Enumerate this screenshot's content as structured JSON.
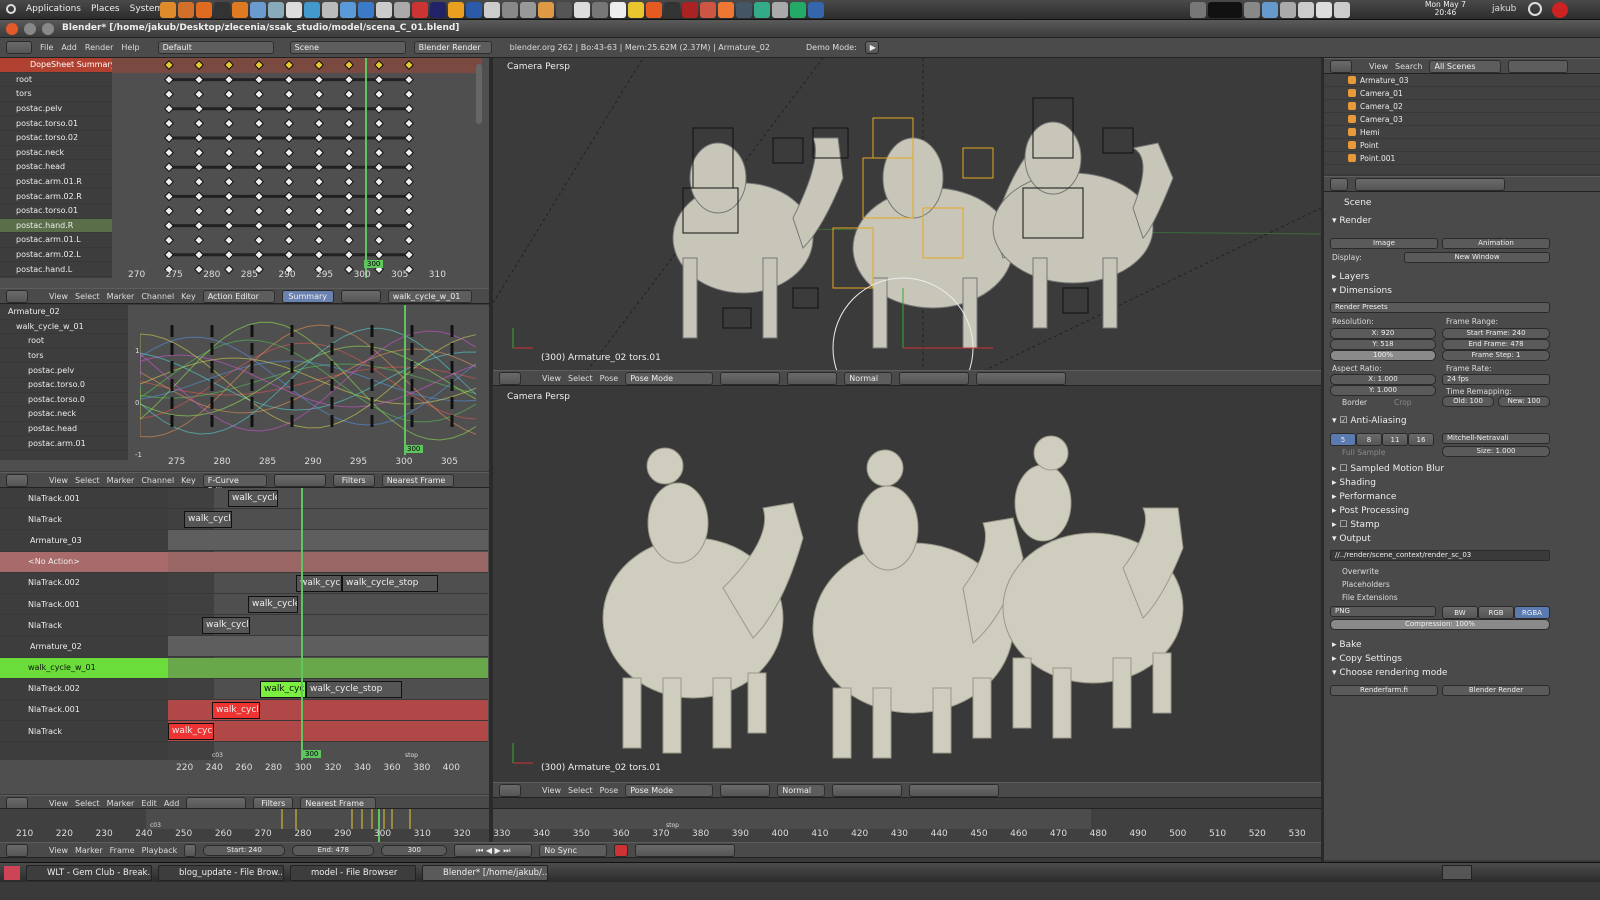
{
  "system_panel": {
    "menus": [
      "Applications",
      "Places",
      "System"
    ],
    "datetime_line1": "Mon May 7",
    "datetime_line2": "20:46",
    "user": "jakub"
  },
  "window": {
    "title": "Blender* [/home/jakub/Desktop/zlecenia/ssak_studio/model/scena_C_01.blend]"
  },
  "info_header": {
    "menus": [
      "File",
      "Add",
      "Render",
      "Help"
    ],
    "layout": "Default",
    "scene": "Scene",
    "engine": "Blender Render",
    "stats": "blender.org 262 | Bo:43-63 | Mem:25.62M (2.37M) | Armature_02",
    "demo_mode": "Demo Mode:"
  },
  "dopesheet": {
    "summary_label": "DopeSheet Summary",
    "channels": [
      "root",
      "tors",
      "postac.pelv",
      "postac.torso.01",
      "postac.torso.02",
      "postac.neck",
      "postac.head",
      "postac.arm.01.R",
      "postac.arm.02.R",
      "postac.torso.01",
      "postac.hand.R",
      "postac.arm.01.L",
      "postac.arm.02.L",
      "postac.hand.L"
    ],
    "ruler": [
      "270",
      "275",
      "280",
      "285",
      "290",
      "295",
      "300",
      "305",
      "310"
    ],
    "current_frame": "300",
    "header_menus": [
      "View",
      "Select",
      "Marker",
      "Channel",
      "Key"
    ],
    "mode": "Action Editor",
    "summary_btn": "Summary",
    "action": "walk_cycle_w_01"
  },
  "fcurve": {
    "channels": [
      "Armature_02",
      "walk_cycle_w_01",
      "root",
      "tors",
      "postac.pelv",
      "postac.torso.0",
      "postac.torso.0",
      "postac.neck",
      "postac.head",
      "postac.arm.01"
    ],
    "ruler": [
      "275",
      "280",
      "285",
      "290",
      "295",
      "300",
      "305"
    ],
    "current_frame": "300",
    "yticks": [
      "1",
      "0",
      "-1"
    ],
    "header_menus": [
      "View",
      "Select",
      "Marker",
      "Channel",
      "Key"
    ],
    "mode": "F-Curve Editor",
    "filters": "Filters",
    "snap": "Nearest Frame"
  },
  "nla": {
    "tracks": [
      {
        "name": "NlaTrack.001",
        "type": "track"
      },
      {
        "name": "NlaTrack",
        "type": "track"
      },
      {
        "name": "Armature_03",
        "type": "object"
      },
      {
        "name": "<No Action>",
        "type": "noaction"
      },
      {
        "name": "NlaTrack.002",
        "type": "track"
      },
      {
        "name": "NlaTrack.001",
        "type": "track"
      },
      {
        "name": "NlaTrack",
        "type": "track"
      },
      {
        "name": "Armature_02",
        "type": "object"
      },
      {
        "name": "walk_cycle_w_01",
        "type": "action"
      },
      {
        "name": "NlaTrack.002",
        "type": "track"
      },
      {
        "name": "NlaTrack.001",
        "type": "track"
      },
      {
        "name": "NlaTrack",
        "type": "track"
      }
    ],
    "strips": [
      {
        "label": "walk_cycle",
        "row": 0
      },
      {
        "label": "walk_cycle",
        "row": 1
      },
      {
        "label": "walk_cycl",
        "row": 4
      },
      {
        "label": "walk_cycle_stop",
        "row": 4
      },
      {
        "label": "walk_cycle",
        "row": 5
      },
      {
        "label": "walk_cycle",
        "row": 6
      },
      {
        "label": "walk_cycle",
        "row": 9
      },
      {
        "label": "walk_cycle_stop",
        "row": 9
      },
      {
        "label": "walk_cycle",
        "row": 10
      },
      {
        "label": "walk_cycle",
        "row": 11
      }
    ],
    "ruler": [
      "220",
      "240",
      "260",
      "280",
      "300",
      "320",
      "340",
      "360",
      "380",
      "400"
    ],
    "current_frame": "300",
    "markers": [
      "c03",
      "stop"
    ],
    "header_menus": [
      "View",
      "Select",
      "Marker",
      "Edit",
      "Add"
    ],
    "filters": "Filters",
    "snap": "Nearest Frame"
  },
  "viewport_top": {
    "label": "Camera Persp",
    "status": "(300) Armature_02 tors.01",
    "menus": [
      "View",
      "Select",
      "Pose"
    ],
    "mode": "Pose Mode",
    "orientation": "Normal"
  },
  "viewport_bottom": {
    "label": "Camera Persp",
    "status": "(300) Armature_02 tors.01",
    "menus": [
      "View",
      "Select",
      "Pose"
    ],
    "mode": "Pose Mode",
    "orientation": "Normal"
  },
  "outliner": {
    "menus": [
      "View",
      "Search"
    ],
    "filter": "All Scenes",
    "items": [
      "Armature_03",
      "Camera_01",
      "Camera_02",
      "Camera_03",
      "Hemi",
      "Point",
      "Point.001"
    ]
  },
  "properties": {
    "context": "Scene",
    "render_header": "Render",
    "image_btn": "Image",
    "animation_btn": "Animation",
    "display_label": "Display:",
    "display_value": "New Window",
    "layers": "Layers",
    "dimensions": "Dimensions",
    "render_presets": "Render Presets",
    "resolution_label": "Resolution:",
    "res_x": "X: 920",
    "res_y": "Y: 518",
    "res_pct": "100%",
    "frame_range_label": "Frame Range:",
    "start_frame": "Start Frame: 240",
    "end_frame": "End Frame: 478",
    "frame_step": "Frame Step: 1",
    "aspect_label": "Aspect Ratio:",
    "aspect_x": "X: 1.000",
    "aspect_y": "Y: 1.000",
    "frame_rate_label": "Frame Rate:",
    "fps": "24 fps",
    "time_remap": "Time Remapping:",
    "old": "Old: 100",
    "new": "New: 100",
    "border": "Border",
    "crop": "Crop",
    "anti_aliasing": "Anti-Aliasing",
    "aa_samples": [
      "5",
      "8",
      "11",
      "16"
    ],
    "aa_filter": "Mitchell-Netravali",
    "full_sample": "Full Sample",
    "aa_size": "Size: 1.000",
    "sampled_motion_blur": "Sampled Motion Blur",
    "shading": "Shading",
    "performance": "Performance",
    "post_processing": "Post Processing",
    "stamp": "Stamp",
    "output": "Output",
    "output_path": "//../render/scene_context/render_sc_03",
    "overwrite": "Overwrite",
    "placeholders": "Placeholders",
    "file_extensions": "File Extensions",
    "format": "PNG",
    "color_modes": [
      "BW",
      "RGB",
      "RGBA"
    ],
    "compression": "Compression: 100%",
    "bake": "Bake",
    "copy_settings": "Copy Settings",
    "choose_rendering_mode": "Choose rendering mode",
    "renderfarm": "Renderfarm.fi",
    "blender_render": "Blender Render"
  },
  "timeline": {
    "ruler": [
      "210",
      "220",
      "230",
      "240",
      "250",
      "260",
      "270",
      "280",
      "290",
      "300",
      "310",
      "320",
      "330",
      "340",
      "350",
      "360",
      "370",
      "380",
      "390",
      "400",
      "410",
      "420",
      "430",
      "440",
      "450",
      "460",
      "470",
      "480",
      "490",
      "500",
      "510",
      "520",
      "530"
    ],
    "markers": [
      "c03",
      "stop"
    ],
    "menus": [
      "View",
      "Marker",
      "Frame",
      "Playback"
    ],
    "start": "Start: 240",
    "end": "End: 478",
    "current": "300",
    "sync": "No Sync"
  },
  "taskbar": {
    "items": [
      "WLT - Gem Club - Break...",
      "blog_update - File Brow...",
      "model - File Browser",
      "Blender* [/home/jakub/..."
    ]
  }
}
